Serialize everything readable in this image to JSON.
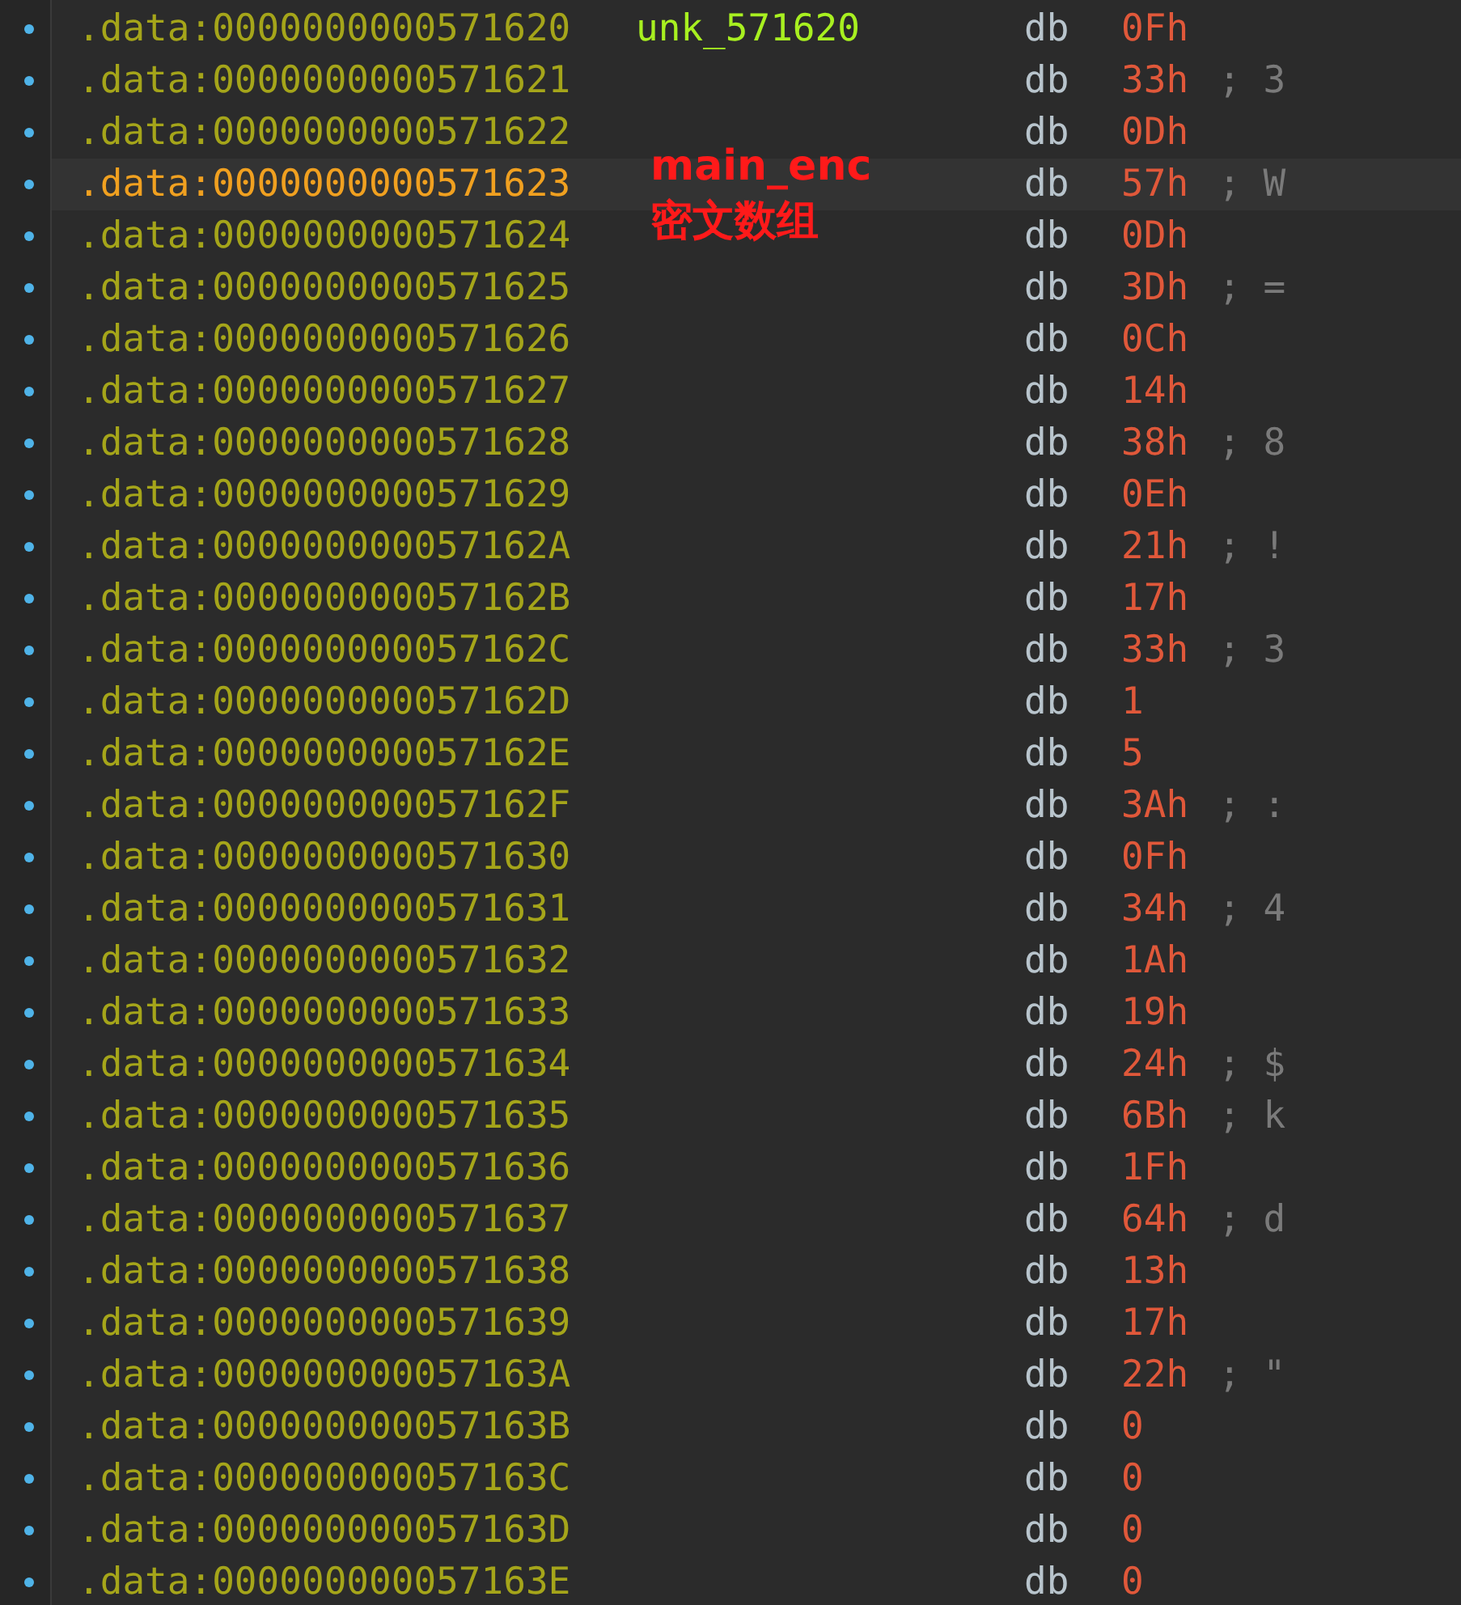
{
  "rows": [
    {
      "address": ".data:0000000000571620",
      "label": "unk_571620",
      "mnemonic": "db",
      "value": "0Fh",
      "selected": false
    },
    {
      "address": ".data:0000000000571621",
      "mnemonic": "db",
      "value": "33h",
      "comment": "; 3",
      "selected": false
    },
    {
      "address": ".data:0000000000571622",
      "mnemonic": "db",
      "value": "0Dh",
      "selected": false
    },
    {
      "address": ".data:0000000000571623",
      "mnemonic": "db",
      "value": "57h",
      "comment": "; W",
      "selected": true
    },
    {
      "address": ".data:0000000000571624",
      "mnemonic": "db",
      "value": "0Dh",
      "selected": false
    },
    {
      "address": ".data:0000000000571625",
      "mnemonic": "db",
      "value": "3Dh",
      "comment": "; =",
      "selected": false
    },
    {
      "address": ".data:0000000000571626",
      "mnemonic": "db",
      "value": "0Ch",
      "selected": false
    },
    {
      "address": ".data:0000000000571627",
      "mnemonic": "db",
      "value": "14h",
      "selected": false
    },
    {
      "address": ".data:0000000000571628",
      "mnemonic": "db",
      "value": "38h",
      "comment": "; 8",
      "selected": false
    },
    {
      "address": ".data:0000000000571629",
      "mnemonic": "db",
      "value": "0Eh",
      "selected": false
    },
    {
      "address": ".data:000000000057162A",
      "mnemonic": "db",
      "value": "21h",
      "comment": "; !",
      "selected": false
    },
    {
      "address": ".data:000000000057162B",
      "mnemonic": "db",
      "value": "17h",
      "selected": false
    },
    {
      "address": ".data:000000000057162C",
      "mnemonic": "db",
      "value": "33h",
      "comment": "; 3",
      "selected": false
    },
    {
      "address": ".data:000000000057162D",
      "mnemonic": "db",
      "value": "1",
      "selected": false
    },
    {
      "address": ".data:000000000057162E",
      "mnemonic": "db",
      "value": "5",
      "selected": false
    },
    {
      "address": ".data:000000000057162F",
      "mnemonic": "db",
      "value": "3Ah",
      "comment": "; :",
      "selected": false
    },
    {
      "address": ".data:0000000000571630",
      "mnemonic": "db",
      "value": "0Fh",
      "selected": false
    },
    {
      "address": ".data:0000000000571631",
      "mnemonic": "db",
      "value": "34h",
      "comment": "; 4",
      "selected": false
    },
    {
      "address": ".data:0000000000571632",
      "mnemonic": "db",
      "value": "1Ah",
      "selected": false
    },
    {
      "address": ".data:0000000000571633",
      "mnemonic": "db",
      "value": "19h",
      "selected": false
    },
    {
      "address": ".data:0000000000571634",
      "mnemonic": "db",
      "value": "24h",
      "comment": "; $",
      "selected": false
    },
    {
      "address": ".data:0000000000571635",
      "mnemonic": "db",
      "value": "6Bh",
      "comment": "; k",
      "selected": false
    },
    {
      "address": ".data:0000000000571636",
      "mnemonic": "db",
      "value": "1Fh",
      "selected": false
    },
    {
      "address": ".data:0000000000571637",
      "mnemonic": "db",
      "value": "64h",
      "comment": "; d",
      "selected": false
    },
    {
      "address": ".data:0000000000571638",
      "mnemonic": "db",
      "value": "13h",
      "selected": false
    },
    {
      "address": ".data:0000000000571639",
      "mnemonic": "db",
      "value": "17h",
      "selected": false
    },
    {
      "address": ".data:000000000057163A",
      "mnemonic": "db",
      "value": "22h",
      "comment": "; \"",
      "selected": false
    },
    {
      "address": ".data:000000000057163B",
      "mnemonic": "db",
      "value": "0",
      "selected": false
    },
    {
      "address": ".data:000000000057163C",
      "mnemonic": "db",
      "value": "0",
      "selected": false
    },
    {
      "address": ".data:000000000057163D",
      "mnemonic": "db",
      "value": "0",
      "selected": false
    },
    {
      "address": ".data:000000000057163E",
      "mnemonic": "db",
      "value": "0",
      "selected": false
    }
  ],
  "annotation": {
    "text": "main_enc\n密文数组"
  }
}
